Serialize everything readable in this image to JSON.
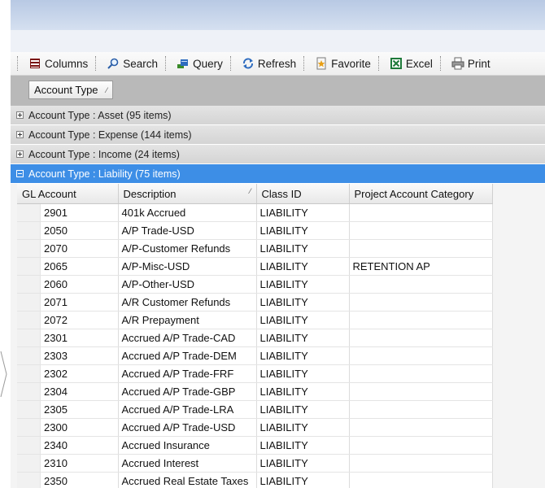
{
  "toolbar": {
    "columns_label": "Columns",
    "search_label": "Search",
    "query_label": "Query",
    "refresh_label": "Refresh",
    "favorite_label": "Favorite",
    "excel_label": "Excel",
    "print_label": "Print"
  },
  "group_by": {
    "field_label": "Account Type",
    "sort_glyph": "⁄"
  },
  "groups": [
    {
      "label": "Account Type : Asset (95 items)",
      "expanded": false
    },
    {
      "label": "Account Type : Expense (144 items)",
      "expanded": false
    },
    {
      "label": "Account Type : Income (24 items)",
      "expanded": false
    },
    {
      "label": "Account Type : Liability (75 items)",
      "expanded": true
    }
  ],
  "grid": {
    "headers": [
      "GL Account",
      "Description",
      "Class ID",
      "Project Account Category"
    ],
    "description_sort_glyph": "⁄",
    "rows": [
      [
        "2901",
        "401k Accrued",
        "LIABILITY",
        ""
      ],
      [
        "2050",
        "A/P Trade-USD",
        "LIABILITY",
        ""
      ],
      [
        "2070",
        "A/P-Customer Refunds",
        "LIABILITY",
        ""
      ],
      [
        "2065",
        "A/P-Misc-USD",
        "LIABILITY",
        "RETENTION AP"
      ],
      [
        "2060",
        "A/P-Other-USD",
        "LIABILITY",
        ""
      ],
      [
        "2071",
        "A/R Customer Refunds",
        "LIABILITY",
        ""
      ],
      [
        "2072",
        "A/R Prepayment",
        "LIABILITY",
        ""
      ],
      [
        "2301",
        "Accrued A/P Trade-CAD",
        "LIABILITY",
        ""
      ],
      [
        "2303",
        "Accrued A/P Trade-DEM",
        "LIABILITY",
        ""
      ],
      [
        "2302",
        "Accrued A/P Trade-FRF",
        "LIABILITY",
        ""
      ],
      [
        "2304",
        "Accrued A/P Trade-GBP",
        "LIABILITY",
        ""
      ],
      [
        "2305",
        "Accrued A/P Trade-LRA",
        "LIABILITY",
        ""
      ],
      [
        "2300",
        "Accrued A/P Trade-USD",
        "LIABILITY",
        ""
      ],
      [
        "2340",
        "Accrued Insurance",
        "LIABILITY",
        ""
      ],
      [
        "2310",
        "Accrued Interest",
        "LIABILITY",
        ""
      ],
      [
        "2350",
        "Accrued Real Estate Taxes",
        "LIABILITY",
        ""
      ]
    ]
  },
  "colors": {
    "active_group": "#3d8ee6",
    "titlebar": "#c6d4ea",
    "groupbar": "#b9b9b9"
  }
}
